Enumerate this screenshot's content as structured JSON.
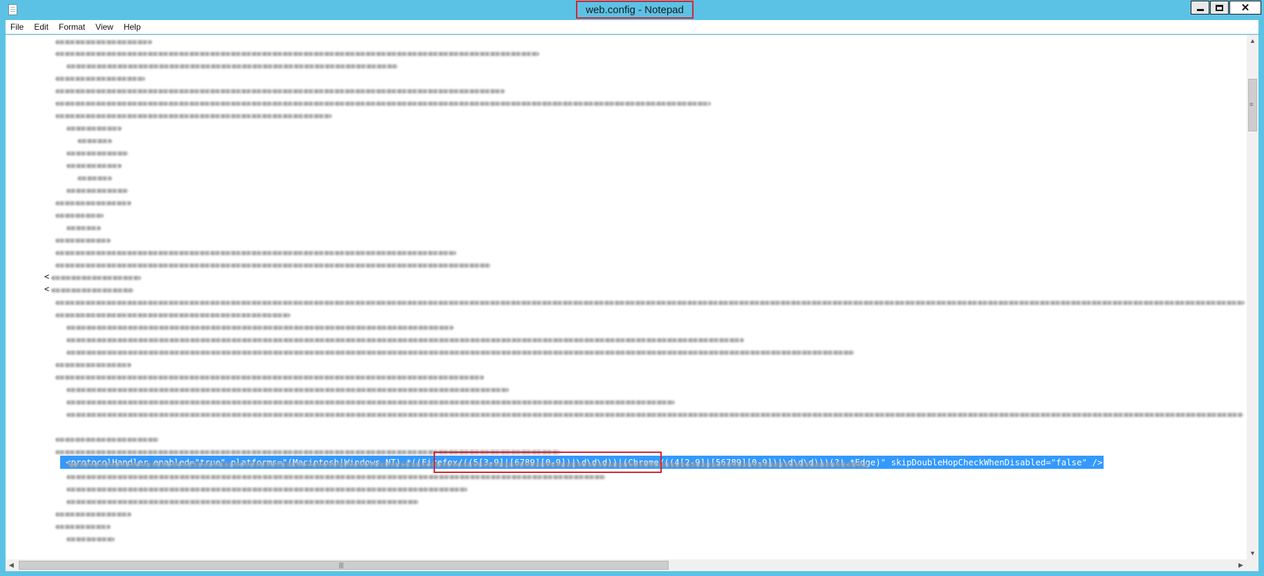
{
  "window": {
    "title": "web.config - Notepad",
    "title_highlight_color": "#d9232a",
    "desktop_color": "#5bc2e6",
    "controls": {
      "minimize_icon": "minimize-icon",
      "maximize_icon": "maximize-icon",
      "close_icon": "close-icon",
      "close_glyph": "✕"
    }
  },
  "menu": {
    "items": [
      {
        "label": "File"
      },
      {
        "label": "Edit"
      },
      {
        "label": "Format"
      },
      {
        "label": "View"
      },
      {
        "label": "Help"
      }
    ]
  },
  "editor": {
    "visible_chars": {
      "line_close": "<",
      "line_open": "<"
    },
    "selected_line": "<protocolHandler enabled=\"true\" platforms=\"(Macintosh|Windows NT).*((Firefox/((5[3-9]|[6789][0-9])|\\d\\d\\d))|(Chrome/((4[2-9]|[56789][0-9])|\\d\\d\\d)))(?!.*Edge)\" skipDoubleHopCheckWhenDisabled=\"false\" />",
    "selection_color": "#3399ff",
    "callout_color": "#d9232a",
    "note": "other lines are blurred"
  },
  "scrollbars": {
    "vertical": {
      "up_arrow": "▲",
      "down_arrow": "▼",
      "grip": "≡",
      "position": 0.08
    },
    "horizontal": {
      "left_arrow": "◀",
      "right_arrow": "▶",
      "grip": "|||",
      "position": 0.0
    }
  }
}
